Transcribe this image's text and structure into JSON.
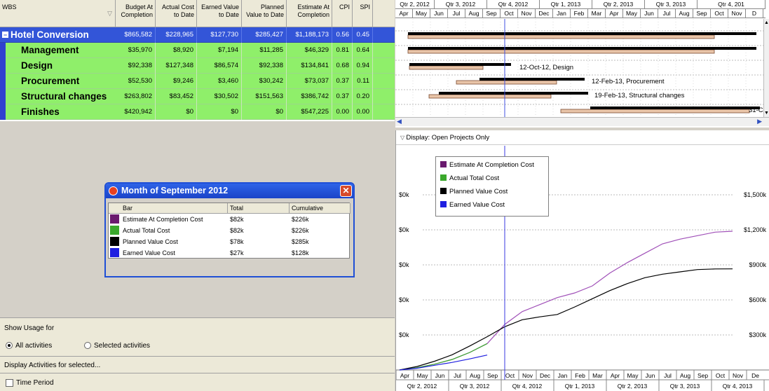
{
  "table": {
    "headers": {
      "wbs": "WBS",
      "bac": [
        "Budget At",
        "Completion"
      ],
      "ac": [
        "Actual Cost",
        "to Date"
      ],
      "ev": [
        "Earned Value",
        "to Date"
      ],
      "pv": [
        "Planned",
        "Value to Date"
      ],
      "eac": [
        "Estimate At",
        "Completion"
      ],
      "cpi": "CPI",
      "spi": "SPI"
    },
    "rows": [
      {
        "name": "Hotel Conversion",
        "bac": "$865,582",
        "ac": "$228,965",
        "ev": "$127,730",
        "pv": "$285,427",
        "eac": "$1,188,173",
        "cpi": "0.56",
        "spi": "0.45",
        "type": "project"
      },
      {
        "name": "Management",
        "bac": "$35,970",
        "ac": "$8,920",
        "ev": "$7,194",
        "pv": "$11,285",
        "eac": "$46,329",
        "cpi": "0.81",
        "spi": "0.64",
        "type": "wbs"
      },
      {
        "name": "Design",
        "bac": "$92,338",
        "ac": "$127,348",
        "ev": "$86,574",
        "pv": "$92,338",
        "eac": "$134,841",
        "cpi": "0.68",
        "spi": "0.94",
        "type": "wbs"
      },
      {
        "name": "Procurement",
        "bac": "$52,530",
        "ac": "$9,246",
        "ev": "$3,460",
        "pv": "$30,242",
        "eac": "$73,037",
        "cpi": "0.37",
        "spi": "0.11",
        "type": "wbs"
      },
      {
        "name": "Structural changes",
        "bac": "$263,802",
        "ac": "$83,452",
        "ev": "$30,502",
        "pv": "$151,563",
        "eac": "$386,742",
        "cpi": "0.37",
        "spi": "0.20",
        "type": "wbs"
      },
      {
        "name": "Finishes",
        "bac": "$420,942",
        "ac": "$0",
        "ev": "$0",
        "pv": "$0",
        "eac": "$547,225",
        "cpi": "0.00",
        "spi": "0.00",
        "type": "wbs"
      }
    ]
  },
  "gantt": {
    "quarters": [
      "Qtr 2, 2012",
      "Qtr 3, 2012",
      "Qtr 4, 2012",
      "Qtr 1, 2013",
      "Qtr 2, 2013",
      "Qtr 3, 2013",
      "Qtr 4, 201"
    ],
    "months": [
      "Apr",
      "May",
      "Jun",
      "Jul",
      "Aug",
      "Sep",
      "Oct",
      "Nov",
      "Dec",
      "Jan",
      "Feb",
      "Mar",
      "Apr",
      "May",
      "Jun",
      "Jul",
      "Aug",
      "Sep",
      "Oct",
      "Nov",
      "D"
    ],
    "labels": {
      "design": "12-Oct-12, Design",
      "procurement": "12-Feb-13, Procurement",
      "structural": "19-Feb-13, Structural changes",
      "finishes": "31-C"
    }
  },
  "display_filter": "Display: Open Projects Only",
  "legend": [
    {
      "label": "Estimate At Completion Cost",
      "color": "#6a1a6e"
    },
    {
      "label": "Actual Total Cost",
      "color": "#3aa82c"
    },
    {
      "label": "Planned Value Cost",
      "color": "#000000"
    },
    {
      "label": "Earned Value Cost",
      "color": "#1f1fe0"
    }
  ],
  "popup": {
    "title": "Month of September 2012",
    "columns": [
      "Bar",
      "Total",
      "Cumulative"
    ],
    "rows": [
      {
        "label": "Estimate At Completion Cost",
        "total": "$82k",
        "cumulative": "$226k",
        "color": "#6a1a6e"
      },
      {
        "label": "Actual Total Cost",
        "total": "$82k",
        "cumulative": "$226k",
        "color": "#3aa82c"
      },
      {
        "label": "Planned Value Cost",
        "total": "$78k",
        "cumulative": "$285k",
        "color": "#000000"
      },
      {
        "label": "Earned Value Cost",
        "total": "$27k",
        "cumulative": "$128k",
        "color": "#1f1fe0"
      }
    ]
  },
  "usage": {
    "show_usage_label": "Show Usage for",
    "all_activities": "All activities",
    "selected_activities": "Selected activities",
    "display_activities_label": "Display Activities for selected...",
    "time_period": "Time Period"
  },
  "chart_data": {
    "type": "line",
    "left_tick_labels": [
      "$0k",
      "$0k",
      "$0k",
      "$0k",
      "$0k"
    ],
    "right_tick_labels": [
      "$1,500k",
      "$1,200k",
      "$900k",
      "$600k",
      "$300k"
    ],
    "ylim": [
      0,
      1800
    ],
    "x_months": [
      "Apr",
      "May",
      "Jun",
      "Jul",
      "Aug",
      "Sep",
      "Oct",
      "Nov",
      "Dec",
      "Jan",
      "Feb",
      "Mar",
      "Apr",
      "May",
      "Jun",
      "Jul",
      "Aug",
      "Sep",
      "Oct",
      "Nov",
      "De"
    ],
    "x_quarters": [
      "Qtr 2, 2012",
      "Qtr 3, 2012",
      "Qtr 4, 2012",
      "Qtr 1, 2013",
      "Qtr 2, 2013",
      "Qtr 3, 2013",
      "Qtr 4, 2013"
    ],
    "series": [
      {
        "name": "Estimate At Completion Cost",
        "color": "#a050b8",
        "values": [
          0,
          20,
          50,
          90,
          150,
          226,
          390,
          500,
          560,
          620,
          660,
          720,
          830,
          920,
          1000,
          1080,
          1120,
          1150,
          1180,
          1188
        ]
      },
      {
        "name": "Actual Total Cost",
        "color": "#3aa82c",
        "values": [
          0,
          20,
          50,
          90,
          150,
          226
        ]
      },
      {
        "name": "Planned Value Cost",
        "color": "#000000",
        "values": [
          0,
          30,
          75,
          130,
          205,
          285,
          370,
          430,
          455,
          475,
          540,
          610,
          680,
          740,
          790,
          820,
          840,
          860,
          865,
          866
        ]
      },
      {
        "name": "Earned Value Cost",
        "color": "#1f1fe0",
        "values": [
          0,
          15,
          40,
          65,
          95,
          128
        ]
      }
    ],
    "current_date_month": "Sep"
  }
}
